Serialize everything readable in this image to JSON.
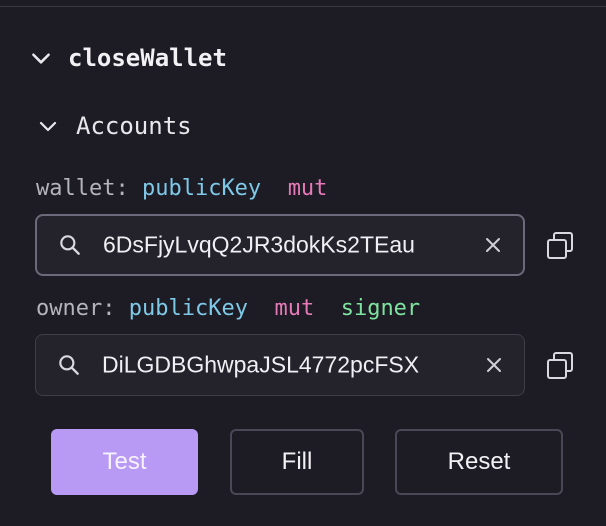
{
  "instruction": {
    "title": "closeWallet",
    "accounts_title": "Accounts"
  },
  "accounts": [
    {
      "name": "wallet:",
      "type": "publicKey",
      "flags": [
        "mut"
      ],
      "value": "6DsFjyLvqQ2JR3dokKs2TEau",
      "focused": true
    },
    {
      "name": "owner:",
      "type": "publicKey",
      "flags": [
        "mut",
        "signer"
      ],
      "value": "DiLGDBGhwpaJSL4772pcFSX",
      "focused": false
    }
  ],
  "buttons": {
    "test": "Test",
    "fill": "Fill",
    "reset": "Reset"
  },
  "colors": {
    "background": "#1d1b23",
    "type": "#7ec8e8",
    "mut": "#e67ab8",
    "signer": "#7fe3a0",
    "primary_button": "#b89af5"
  },
  "icons": {
    "collapse": "chevron-down-icon",
    "search": "search-icon",
    "clear": "close-icon",
    "copy": "copy-icon"
  }
}
